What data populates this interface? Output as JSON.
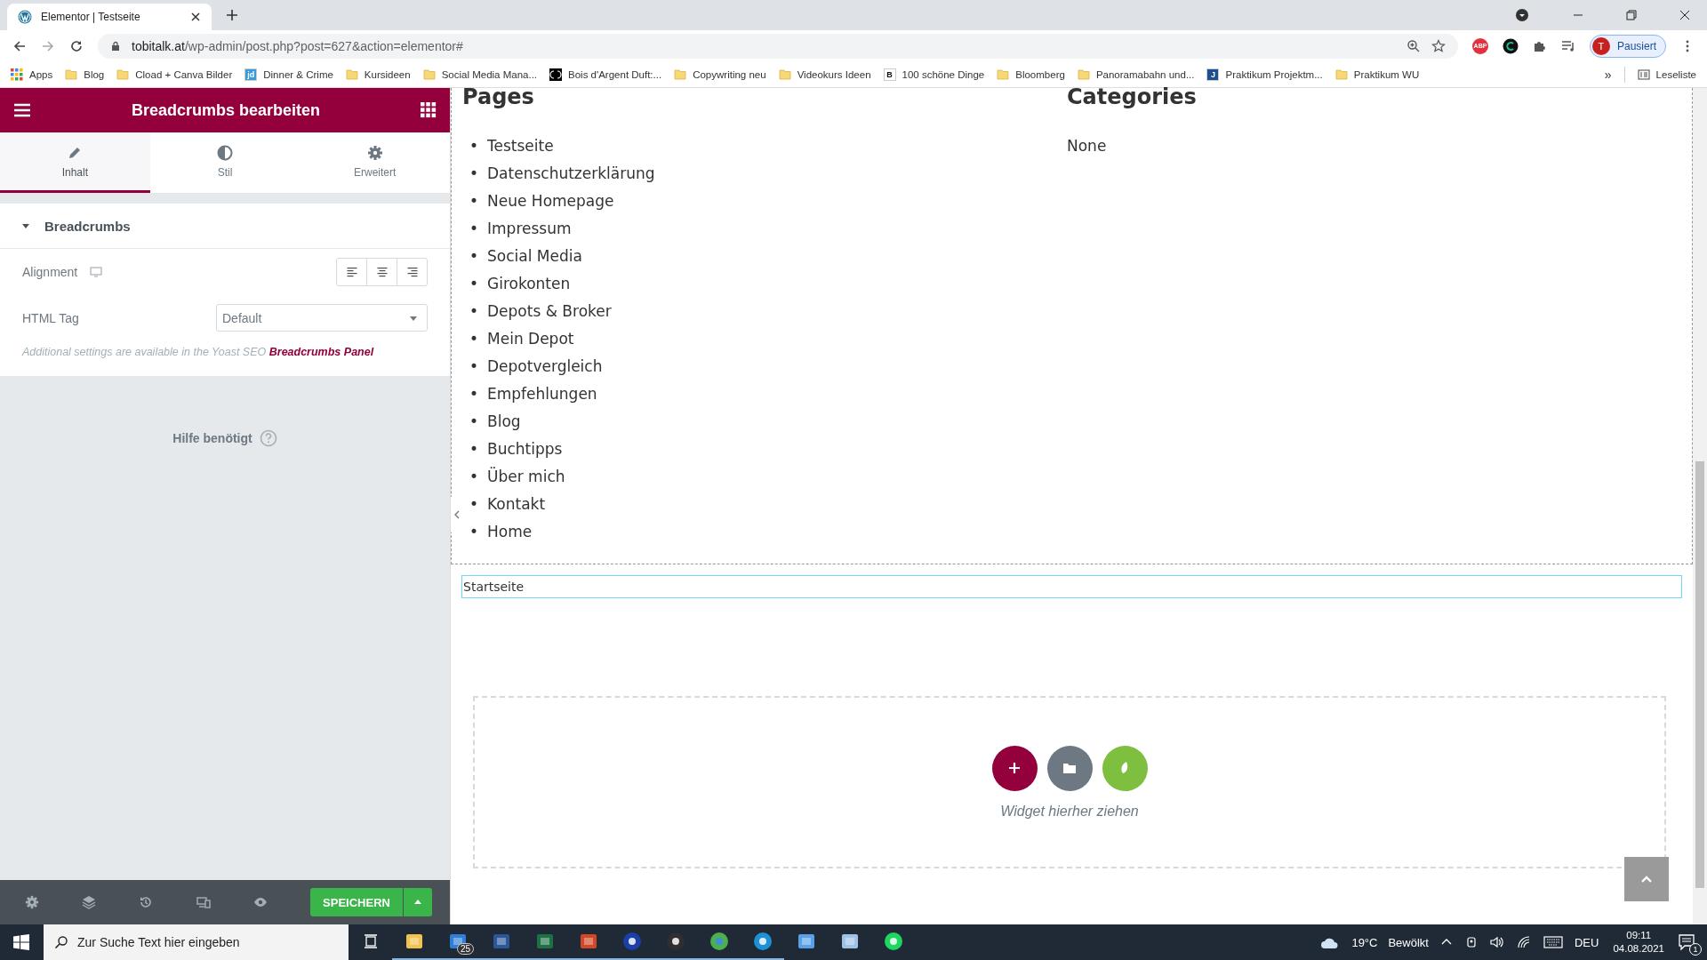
{
  "browser": {
    "tab": {
      "title": "Elementor | Testseite",
      "selected": true
    },
    "url": {
      "host": "tobitalk.at",
      "path": "/wp-admin/post.php?post=627&action=elementor#"
    },
    "extensions": [
      {
        "kind": "abp",
        "text": "ABP"
      },
      {
        "kind": "grammarly"
      },
      {
        "kind": "puzzle"
      },
      {
        "kind": "playlist"
      }
    ],
    "profile": {
      "initial": "T",
      "label": "Pausiert"
    },
    "bookmarks": [
      {
        "kind": "apps",
        "label": "Apps"
      },
      {
        "kind": "folder",
        "label": "Blog"
      },
      {
        "kind": "folder",
        "label": "Cload + Canva Bilder"
      },
      {
        "kind": "site",
        "icon_text": "jd",
        "color": "#3b9ad9",
        "label": "Dinner & Crime"
      },
      {
        "kind": "folder",
        "label": "Kursideen"
      },
      {
        "kind": "folder",
        "label": "Social Media Mana..."
      },
      {
        "kind": "logo",
        "color": "#000000",
        "label": "Bois d'Argent Duft:..."
      },
      {
        "kind": "folder",
        "label": "Copywriting neu"
      },
      {
        "kind": "folder",
        "label": "Videokurs Ideen"
      },
      {
        "kind": "site",
        "icon_text": "B",
        "color": "#ffffff",
        "label": "100 schöne Dinge"
      },
      {
        "kind": "folder",
        "label": "Bloomberg"
      },
      {
        "kind": "folder",
        "label": "Panoramabahn und..."
      },
      {
        "kind": "site",
        "icon_text": "J",
        "color": "#1f4e8c",
        "label": "Praktikum Projektm..."
      },
      {
        "kind": "folder",
        "label": "Praktikum WU"
      }
    ],
    "more": "»",
    "reading_list": "Leseliste"
  },
  "panel": {
    "title": "Breadcrumbs bearbeiten",
    "tabs": [
      {
        "label": "Inhalt",
        "selected": true
      },
      {
        "label": "Stil",
        "selected": false
      },
      {
        "label": "Erweitert",
        "selected": false
      }
    ],
    "section": {
      "title": "Breadcrumbs",
      "expanded": true
    },
    "alignment": {
      "label": "Alignment",
      "options": [
        {
          "kind": "left",
          "selected": false
        },
        {
          "kind": "center",
          "selected": false
        },
        {
          "kind": "right",
          "selected": false
        }
      ]
    },
    "html_tag": {
      "label": "HTML Tag",
      "value": "Default"
    },
    "note": {
      "text": "Additional settings are available in the Yoast SEO",
      "link": "Breadcrumbs Panel"
    },
    "help": "Hilfe benötigt",
    "save": "SPEICHERN"
  },
  "preview": {
    "pages": {
      "heading": "Pages",
      "marker": "•",
      "items": [
        "Testseite",
        "Datenschutzerklärung",
        "Neue Homepage",
        "Impressum",
        "Social Media",
        "Girokonten",
        "Depots & Broker",
        "Mein Depot",
        "Depotvergleich",
        "Empfehlungen",
        "Blog",
        "Buchtipps",
        "Über mich",
        "Kontakt",
        "Home"
      ]
    },
    "categories": {
      "heading": "Categories",
      "items": [
        "None"
      ]
    },
    "breadcrumb": "Startseite",
    "dropzone": "Widget hierher ziehen"
  },
  "taskbar": {
    "search_placeholder": "Zur Suche Text hier eingeben",
    "apps": [
      {
        "kind": "taskview",
        "active": false
      },
      {
        "kind": "explorer",
        "active": true
      },
      {
        "kind": "mail",
        "active": true,
        "badge": "25"
      },
      {
        "kind": "word",
        "active": true
      },
      {
        "kind": "excel",
        "active": true
      },
      {
        "kind": "powerpoint",
        "active": true
      },
      {
        "kind": "audio",
        "active": true
      },
      {
        "kind": "obs",
        "active": true
      },
      {
        "kind": "chrome",
        "active": true
      },
      {
        "kind": "edge",
        "active": true
      },
      {
        "kind": "paint",
        "active": false
      },
      {
        "kind": "notepad",
        "active": false
      },
      {
        "kind": "spotify",
        "active": false
      }
    ],
    "weather": {
      "temp": "19°C",
      "text": "Bewölkt"
    },
    "language": "DEU",
    "time": "09:11",
    "date": "04.08.2021",
    "notifications": "1"
  }
}
